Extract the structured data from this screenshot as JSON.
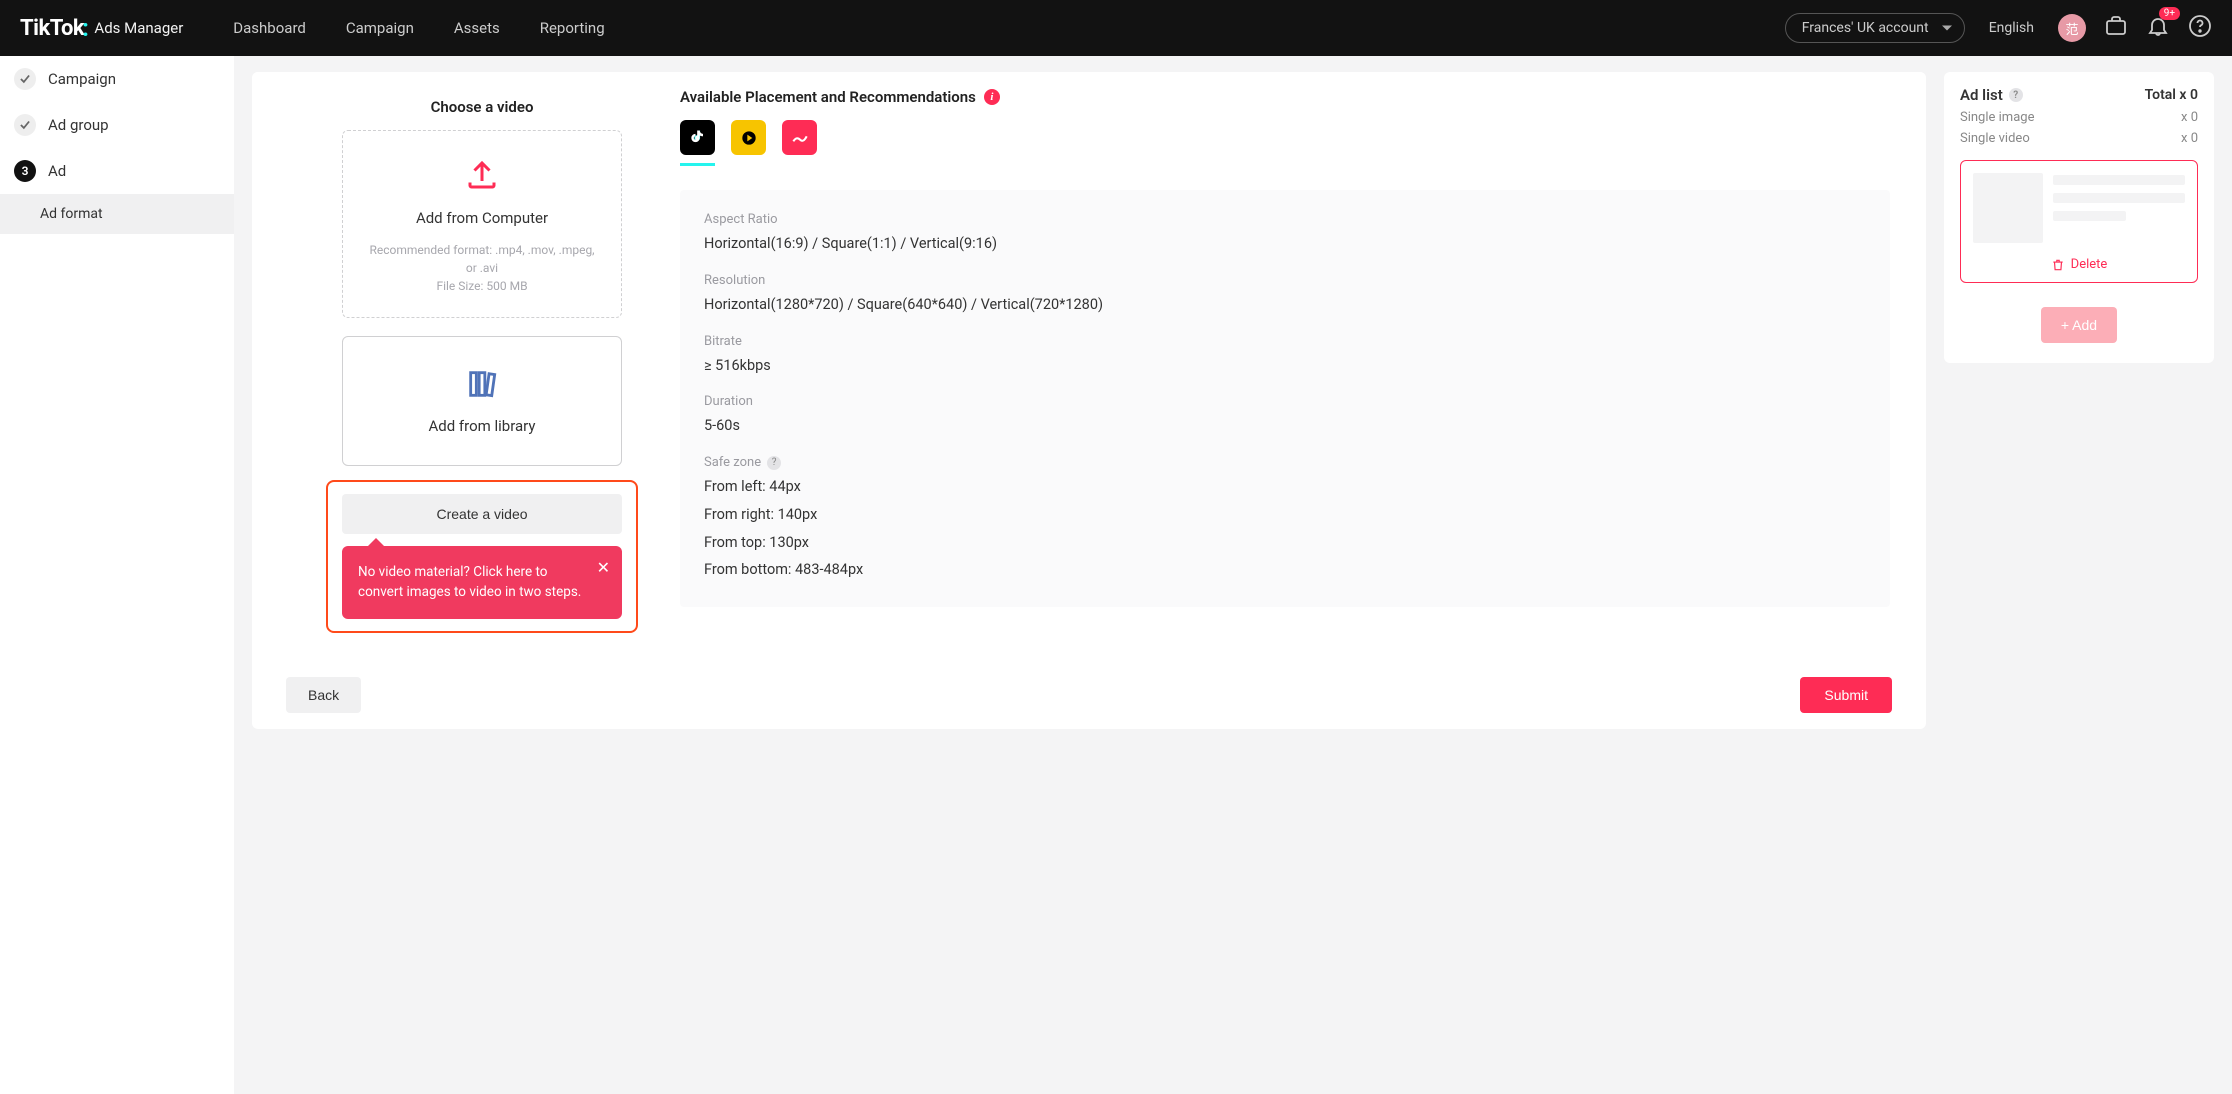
{
  "header": {
    "brand": "TikTok",
    "brand_sub": "Ads Manager",
    "nav": {
      "dashboard": "Dashboard",
      "campaign": "Campaign",
      "assets": "Assets",
      "reporting": "Reporting"
    },
    "account": "Frances' UK account",
    "language": "English",
    "avatar_glyph": "范",
    "notif_badge": "9+"
  },
  "sidebar": {
    "campaign": "Campaign",
    "adgroup": "Ad group",
    "ad": "Ad",
    "ad_step_num": "3",
    "adformat": "Ad format"
  },
  "video": {
    "title": "Choose a video",
    "upload": {
      "title": "Add from Computer",
      "hint1": "Recommended format: .mp4, .mov, .mpeg, or .avi",
      "hint2": "File Size: 500 MB"
    },
    "library": {
      "title": "Add from library"
    },
    "create_btn": "Create a video",
    "tooltip": "No video material? Click here to convert images to video in two steps."
  },
  "placement": {
    "title": "Available Placement and Recommendations",
    "spec": {
      "aspect_label": "Aspect Ratio",
      "aspect_val": "Horizontal(16:9) / Square(1:1) / Vertical(9:16)",
      "res_label": "Resolution",
      "res_val": "Horizontal(1280*720) / Square(640*640) / Vertical(720*1280)",
      "bitrate_label": "Bitrate",
      "bitrate_val": "≥ 516kbps",
      "duration_label": "Duration",
      "duration_val": "5-60s",
      "safezone_label": "Safe zone",
      "sz_left": "From left: 44px",
      "sz_right": "From right: 140px",
      "sz_top": "From top: 130px",
      "sz_bottom": "From bottom: 483-484px"
    }
  },
  "adlist": {
    "title": "Ad list",
    "total": "Total x 0",
    "row1_label": "Single image",
    "row1_val": "x 0",
    "row2_label": "Single video",
    "row2_val": "x 0",
    "delete": "Delete",
    "add_btn": "+ Add"
  },
  "footer": {
    "back": "Back",
    "submit": "Submit"
  }
}
